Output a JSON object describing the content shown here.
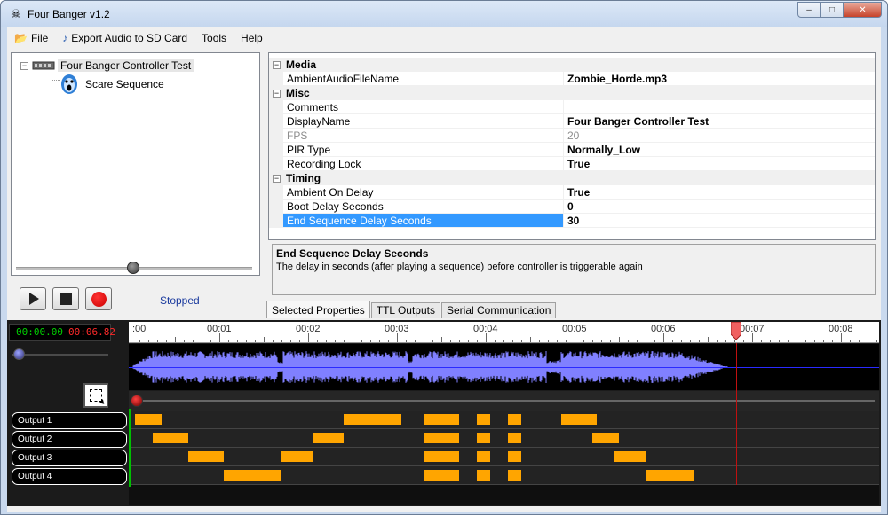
{
  "window": {
    "title": "Four Banger v1.2",
    "controls": {
      "minimize": "–",
      "maximize": "□",
      "close": "✕"
    }
  },
  "menu": {
    "file": "File",
    "export": "Export Audio to SD Card",
    "tools": "Tools",
    "help": "Help"
  },
  "tree": {
    "root_expander": "−",
    "root_label": "Four Banger Controller Test",
    "child_label": "Scare Sequence"
  },
  "transport": {
    "status": "Stopped",
    "volume_level": 0.48
  },
  "properties": {
    "categories": [
      {
        "expander": "−",
        "name": "Media"
      },
      {
        "expander": "−",
        "name": "Misc"
      },
      {
        "expander": "−",
        "name": "Timing"
      }
    ],
    "rows": [
      {
        "name": "AmbientAudioFileName",
        "value": "Zombie_Horde.mp3",
        "disabled": false
      },
      {
        "name": "Comments",
        "value": "",
        "disabled": false
      },
      {
        "name": "DisplayName",
        "value": "Four Banger Controller Test",
        "disabled": false
      },
      {
        "name": "FPS",
        "value": "20",
        "disabled": true
      },
      {
        "name": "PIR Type",
        "value": "Normally_Low",
        "disabled": false
      },
      {
        "name": "Recording Lock",
        "value": "True",
        "disabled": false
      },
      {
        "name": "Ambient On Delay",
        "value": "True",
        "disabled": false
      },
      {
        "name": "Boot Delay Seconds",
        "value": "0",
        "disabled": false
      },
      {
        "name": "End Sequence Delay Seconds",
        "value": "30",
        "disabled": false,
        "selected": true
      }
    ]
  },
  "description": {
    "title": "End Sequence Delay Seconds",
    "text": "The delay in seconds (after playing a sequence) before controller is triggerable again"
  },
  "tabs": [
    "Selected Properties",
    "TTL Outputs",
    "Serial Communication"
  ],
  "timeline": {
    "current_time": "00:00.00",
    "total_time": "00:06.82",
    "ruler_labels": [
      ":00",
      "00:01",
      "00:02",
      "00:03",
      "00:04",
      "00:05",
      "00:06",
      "00:07",
      "00:08"
    ],
    "playhead_seconds": 6.82,
    "outputs": [
      {
        "label": "Output 1",
        "blocks": [
          [
            0.05,
            0.35
          ],
          [
            2.4,
            3.05
          ],
          [
            3.3,
            3.7
          ],
          [
            3.9,
            4.05
          ],
          [
            4.25,
            4.4
          ],
          [
            4.85,
            5.25
          ]
        ]
      },
      {
        "label": "Output 2",
        "blocks": [
          [
            0.25,
            0.65
          ],
          [
            2.05,
            2.4
          ],
          [
            3.3,
            3.7
          ],
          [
            3.9,
            4.05
          ],
          [
            4.25,
            4.4
          ],
          [
            5.2,
            5.5
          ]
        ]
      },
      {
        "label": "Output 3",
        "blocks": [
          [
            0.65,
            1.05
          ],
          [
            1.7,
            2.05
          ],
          [
            3.3,
            3.7
          ],
          [
            3.9,
            4.05
          ],
          [
            4.25,
            4.4
          ],
          [
            5.45,
            5.8
          ]
        ]
      },
      {
        "label": "Output 4",
        "blocks": [
          [
            1.05,
            1.7
          ],
          [
            3.3,
            3.7
          ],
          [
            3.9,
            4.05
          ],
          [
            4.25,
            4.4
          ],
          [
            5.8,
            6.35
          ]
        ]
      }
    ]
  },
  "colors": {
    "waveform": "#8080ff",
    "block": "#ffa500",
    "playhead": "#c01010"
  }
}
